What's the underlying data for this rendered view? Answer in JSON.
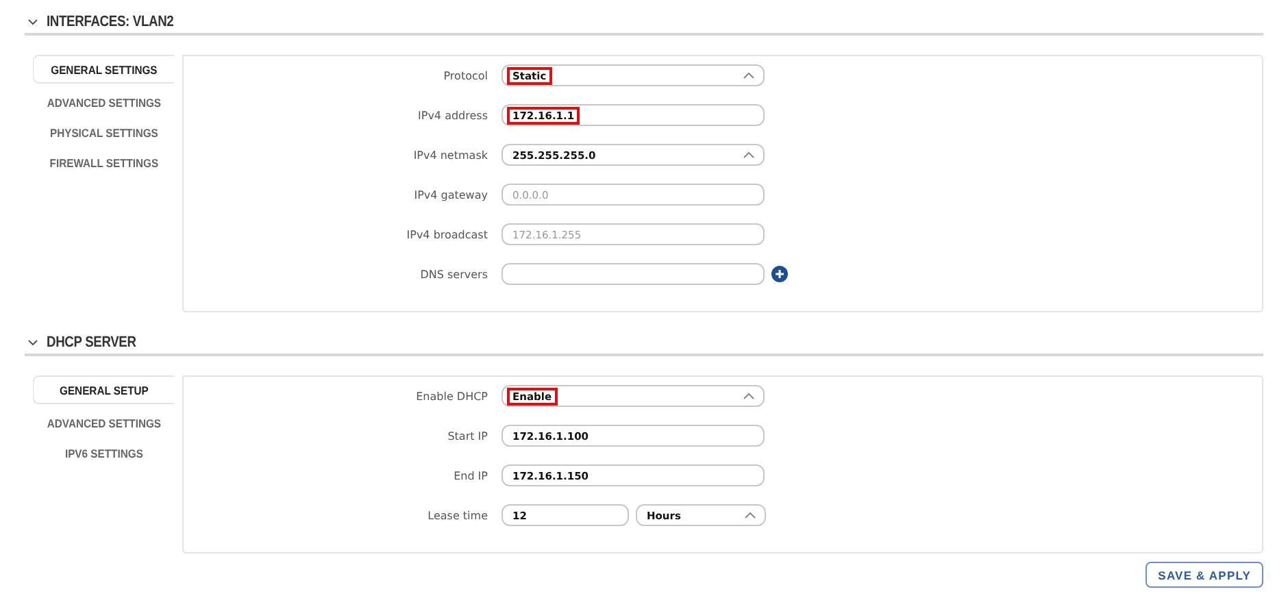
{
  "sections": [
    {
      "title": "INTERFACES: VLAN2",
      "tabs": [
        {
          "label": "GENERAL SETTINGS",
          "selected": true
        },
        {
          "label": "ADVANCED SETTINGS",
          "selected": false
        },
        {
          "label": "PHYSICAL SETTINGS",
          "selected": false
        },
        {
          "label": "FIREWALL SETTINGS",
          "selected": false
        }
      ],
      "fields": [
        {
          "label": "Protocol",
          "kind": "select",
          "value": "Static",
          "highlighted": true
        },
        {
          "label": "IPv4 address",
          "kind": "text",
          "value": "172.16.1.1",
          "highlighted": true
        },
        {
          "label": "IPv4 netmask",
          "kind": "select",
          "value": "255.255.255.0",
          "highlighted": false
        },
        {
          "label": "IPv4 gateway",
          "kind": "text",
          "placeholder": "0.0.0.0",
          "highlighted": false
        },
        {
          "label": "IPv4 broadcast",
          "kind": "text",
          "placeholder": "172.16.1.255",
          "highlighted": false
        },
        {
          "label": "DNS servers",
          "kind": "list",
          "highlighted": false
        }
      ]
    },
    {
      "title": "DHCP SERVER",
      "tabs": [
        {
          "label": "GENERAL SETUP",
          "selected": true
        },
        {
          "label": "ADVANCED SETTINGS",
          "selected": false
        },
        {
          "label": "IPV6 SETTINGS",
          "selected": false
        }
      ],
      "fields": [
        {
          "label": "Enable DHCP",
          "kind": "select",
          "value": "Enable",
          "highlighted": true
        },
        {
          "label": "Start IP",
          "kind": "text",
          "value": "172.16.1.100",
          "highlighted": false
        },
        {
          "label": "End IP",
          "kind": "text",
          "value": "172.16.1.150",
          "highlighted": false
        },
        {
          "label": "Lease time",
          "kind": "text_unit",
          "value": "12",
          "unit": "Hours",
          "highlighted": false
        }
      ]
    }
  ],
  "save_button": "SAVE & APPLY"
}
